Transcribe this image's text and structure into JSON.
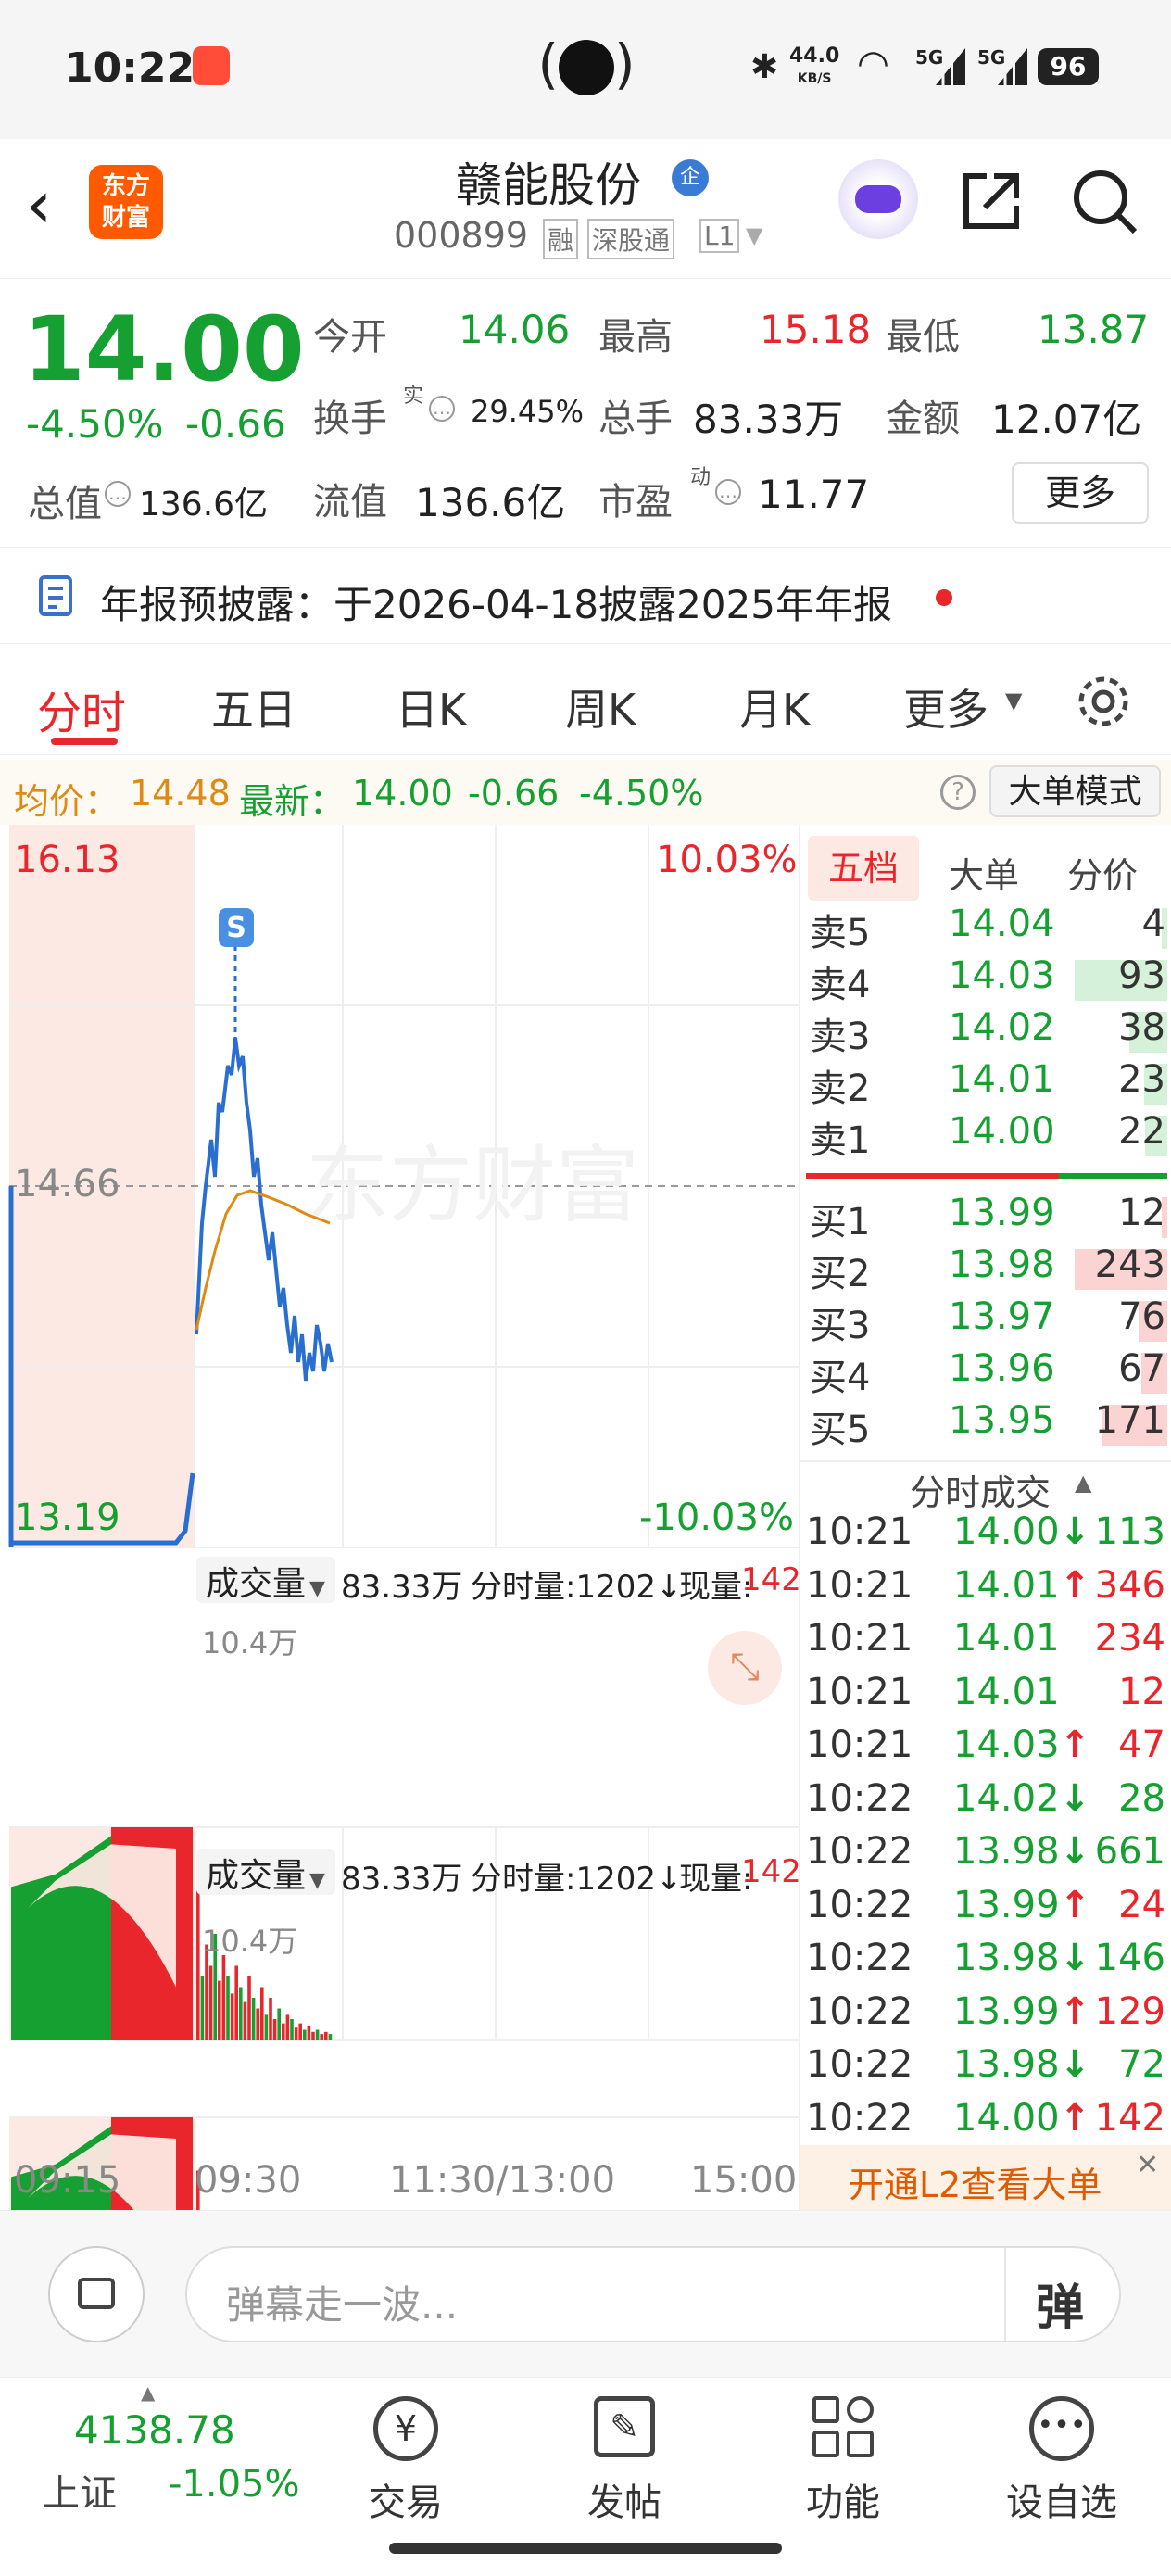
{
  "status": {
    "time": "10:22",
    "net_speed_val": "44.0",
    "net_speed_unit": "KB/S",
    "battery": "96",
    "sig1": "5G",
    "sig2": "5G"
  },
  "header": {
    "logo_line1": "东方",
    "logo_line2": "财富",
    "title": "赣能股份",
    "title_badge": "企",
    "code": "000899",
    "tag1": "融",
    "tag2": "深股通",
    "tag3": "L1"
  },
  "quote": {
    "price": "14.00",
    "pct": "-4.50%",
    "chg": "-0.66",
    "open_label": "今开",
    "open": "14.06",
    "high_label": "最高",
    "high": "15.18",
    "low_label": "最低",
    "low": "13.87",
    "turnover_label": "换手",
    "turnover_sup": "实",
    "turnover": "29.45%",
    "vol_label": "总手",
    "vol": "83.33万",
    "amt_label": "金额",
    "amt": "12.07亿",
    "mcap_label": "总值",
    "mcap": "136.6亿",
    "float_label": "流值",
    "float": "136.6亿",
    "pe_label": "市盈",
    "pe_sup": "动",
    "pe": "11.77",
    "more": "更多"
  },
  "notice": {
    "text": "年报预披露：于2026-04-18披露2025年年报"
  },
  "tabs": [
    "分时",
    "五日",
    "日K",
    "周K",
    "月K",
    "更多"
  ],
  "pricebar": {
    "avg_label": "均价：",
    "avg": "14.48",
    "last_label": "最新：",
    "last": "14.00",
    "chg": "-0.66",
    "pct": "-4.50%",
    "mode": "大单模式"
  },
  "chart": {
    "y_top": "16.13",
    "y_mid": "14.66",
    "y_bot": "13.19",
    "pct_top": "10.03%",
    "pct_bot": "-10.03%",
    "marker": "S",
    "watermark": "东方财富",
    "vol_label": "成交量",
    "vol_total": "83.33万",
    "tick_vol": "分时量:1202↓",
    "cur_vol_label": "现量:",
    "cur_vol": "142",
    "vol_max": "10.4万",
    "times": [
      "09:15",
      "09:30",
      "11:30/13:00",
      "15:00"
    ]
  },
  "book": {
    "tabs": [
      "五档",
      "大单",
      "分价"
    ],
    "asks": [
      {
        "label": "卖5",
        "price": "14.04",
        "vol": "4"
      },
      {
        "label": "卖4",
        "price": "14.03",
        "vol": "93"
      },
      {
        "label": "卖3",
        "price": "14.02",
        "vol": "38"
      },
      {
        "label": "卖2",
        "price": "14.01",
        "vol": "23"
      },
      {
        "label": "卖1",
        "price": "14.00",
        "vol": "22"
      }
    ],
    "bids": [
      {
        "label": "买1",
        "price": "13.99",
        "vol": "12"
      },
      {
        "label": "买2",
        "price": "13.98",
        "vol": "243"
      },
      {
        "label": "买3",
        "price": "13.97",
        "vol": "76"
      },
      {
        "label": "买4",
        "price": "13.96",
        "vol": "67"
      },
      {
        "label": "买5",
        "price": "13.95",
        "vol": "171"
      }
    ],
    "ticks_title": "分时成交",
    "ticks": [
      {
        "t": "10:21",
        "p": "14.00↓",
        "v": "113",
        "c": "g"
      },
      {
        "t": "10:21",
        "p": "14.01↑",
        "v": "346",
        "c": "r"
      },
      {
        "t": "10:21",
        "p": "14.01",
        "v": "234",
        "c": "r"
      },
      {
        "t": "10:21",
        "p": "14.01",
        "v": "12",
        "c": "r"
      },
      {
        "t": "10:21",
        "p": "14.03↑",
        "v": "47",
        "c": "r"
      },
      {
        "t": "10:22",
        "p": "14.02↓",
        "v": "28",
        "c": "g"
      },
      {
        "t": "10:22",
        "p": "13.98↓",
        "v": "661",
        "c": "g"
      },
      {
        "t": "10:22",
        "p": "13.99↑",
        "v": "24",
        "c": "r"
      },
      {
        "t": "10:22",
        "p": "13.98↓",
        "v": "146",
        "c": "g"
      },
      {
        "t": "10:22",
        "p": "13.99↑",
        "v": "129",
        "c": "r"
      },
      {
        "t": "10:22",
        "p": "13.98↓",
        "v": "72",
        "c": "g"
      },
      {
        "t": "10:22",
        "p": "14.00↑",
        "v": "142",
        "c": "r"
      }
    ],
    "l2": "开通L2查看大单"
  },
  "danmu": {
    "placeholder": "弹幕走一波..."
  },
  "nav": {
    "index_val": "4138.78",
    "index_name": "上证",
    "index_pct": "-1.05%",
    "items": [
      "交易",
      "发帖",
      "功能",
      "设自选"
    ]
  },
  "colors": {
    "up": "#e8262b",
    "down": "#15a031",
    "accent": "#ff5a00"
  }
}
